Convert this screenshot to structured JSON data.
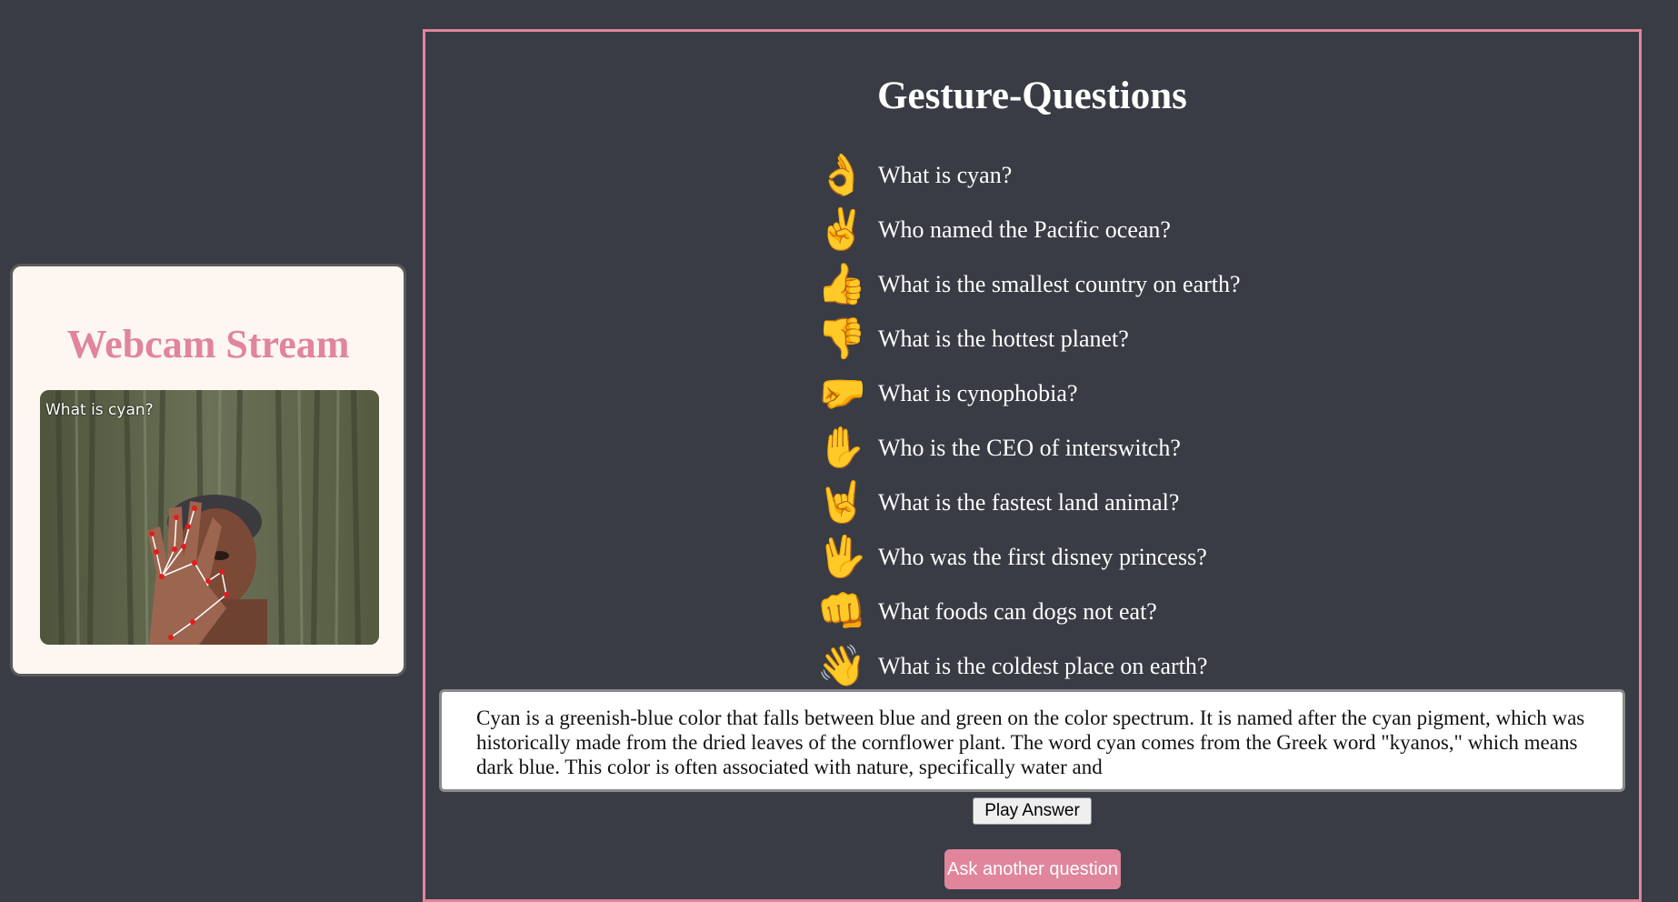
{
  "webcam": {
    "title": "Webcam Stream",
    "overlay_text": "What is cyan?"
  },
  "main": {
    "title": "Gesture-Questions",
    "gestures": [
      {
        "icon": "ok-hand-icon",
        "glyph": "👌",
        "question": "What is cyan?"
      },
      {
        "icon": "victory-hand-icon",
        "glyph": "✌",
        "question": "Who named the Pacific ocean?"
      },
      {
        "icon": "thumbs-up-icon",
        "glyph": "👍",
        "question": "What is the smallest country on earth?"
      },
      {
        "icon": "thumbs-down-icon",
        "glyph": "👎",
        "question": "What is the hottest planet?"
      },
      {
        "icon": "left-facing-fist-icon",
        "glyph": "🤛",
        "question": "What is cynophobia?"
      },
      {
        "icon": "raised-hand-icon",
        "glyph": "✋",
        "question": "Who is the CEO of interswitch?"
      },
      {
        "icon": "sign-of-horns-icon",
        "glyph": "🤘",
        "question": "What is the fastest land animal?"
      },
      {
        "icon": "vulcan-salute-icon",
        "glyph": "🖖",
        "question": "Who was the first disney princess?"
      },
      {
        "icon": "oncoming-fist-icon",
        "glyph": "👊",
        "question": "What foods can dogs not eat?"
      },
      {
        "icon": "waving-hand-icon",
        "glyph": "👋",
        "question": "What is the coldest place on earth?"
      }
    ],
    "answer_text": "Cyan is a greenish-blue color that falls between blue and green on the color spectrum. It is named after the cyan pigment, which was historically made from the dried leaves of the cornflower plant. The word cyan comes from the Greek word \"kyanos,\" which means dark blue. This color is often associated with nature, specifically water and",
    "play_button_label": "Play Answer",
    "ask_button_label": "Ask another question"
  },
  "colors": {
    "background": "#393c44",
    "accent_pink": "#e0859c",
    "card_background": "#fdf6f1",
    "emoji_yellow": "#f3b21e"
  }
}
